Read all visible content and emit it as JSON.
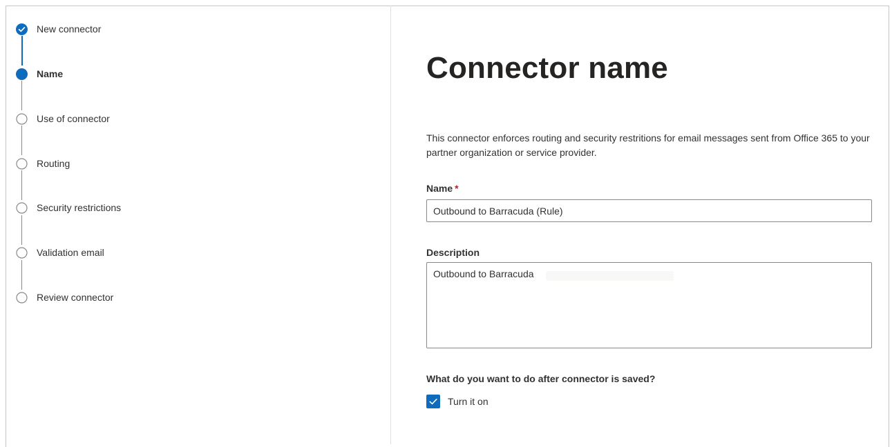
{
  "stepper": {
    "steps": [
      {
        "label": "New connector",
        "state": "completed"
      },
      {
        "label": "Name",
        "state": "current"
      },
      {
        "label": "Use of connector",
        "state": "pending"
      },
      {
        "label": "Routing",
        "state": "pending"
      },
      {
        "label": "Security restrictions",
        "state": "pending"
      },
      {
        "label": "Validation email",
        "state": "pending"
      },
      {
        "label": "Review connector",
        "state": "pending"
      }
    ]
  },
  "main": {
    "title": "Connector name",
    "description": "This connector enforces routing and security restritions for email messages sent from Office 365 to your partner organization or service provider.",
    "name_field": {
      "label": "Name",
      "required_mark": "*",
      "value": "Outbound to Barracuda (Rule)"
    },
    "description_field": {
      "label": "Description",
      "value": "Outbound to Barracuda"
    },
    "after_save": {
      "question": "What do you want to do after connector is saved?",
      "checkbox_label": "Turn it on",
      "checked": true
    }
  },
  "colors": {
    "accent": "#0f6cbd",
    "text": "#323130",
    "border": "#8a8886",
    "required": "#a4262c"
  }
}
